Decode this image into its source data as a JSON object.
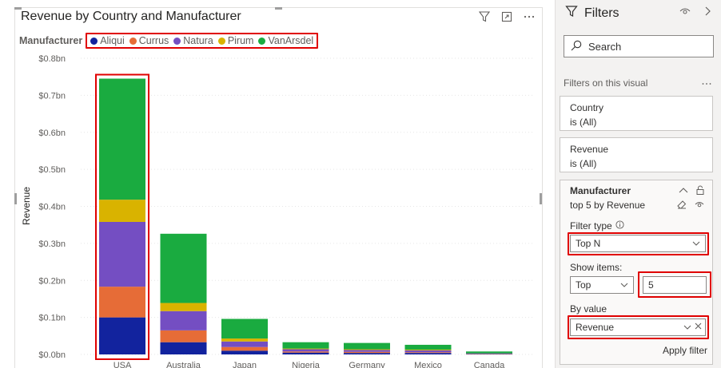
{
  "visual": {
    "title": "Revenue by Country and Manufacturer",
    "legend_title": "Manufacturer",
    "legend": [
      {
        "name": "Aliqui",
        "color": "#12239e"
      },
      {
        "name": "Currus",
        "color": "#e66c37"
      },
      {
        "name": "Natura",
        "color": "#744ec2"
      },
      {
        "name": "Pirum",
        "color": "#d9b300"
      },
      {
        "name": "VanArsdel",
        "color": "#1aab40"
      }
    ],
    "actions": [
      "filter-icon",
      "focus-mode-icon",
      "more-options-icon"
    ]
  },
  "chart_data": {
    "type": "bar",
    "stacked": true,
    "ylabel": "Revenue",
    "ylim": [
      0,
      0.8
    ],
    "yticks": [
      "$0.0bn",
      "$0.1bn",
      "$0.2bn",
      "$0.3bn",
      "$0.4bn",
      "$0.5bn",
      "$0.6bn",
      "$0.7bn",
      "$0.8bn"
    ],
    "grid": true,
    "categories": [
      "USA",
      "Australia",
      "Japan",
      "Nigeria",
      "Germany",
      "Mexico",
      "Canada"
    ],
    "series": [
      {
        "name": "Aliqui",
        "color": "#12239e",
        "values": [
          0.1,
          0.033,
          0.01,
          0.005,
          0.004,
          0.004,
          0.001
        ]
      },
      {
        "name": "Currus",
        "color": "#e66c37",
        "values": [
          0.083,
          0.032,
          0.01,
          0.003,
          0.003,
          0.002,
          0.001
        ]
      },
      {
        "name": "Natura",
        "color": "#744ec2",
        "values": [
          0.175,
          0.052,
          0.015,
          0.006,
          0.005,
          0.005,
          0.001
        ]
      },
      {
        "name": "Pirum",
        "color": "#d9b300",
        "values": [
          0.06,
          0.022,
          0.008,
          0.002,
          0.002,
          0.002,
          0.0
        ]
      },
      {
        "name": "VanArsdel",
        "color": "#1aab40",
        "values": [
          0.327,
          0.187,
          0.053,
          0.017,
          0.017,
          0.013,
          0.005
        ]
      }
    ]
  },
  "filters": {
    "title": "Filters",
    "search_placeholder": "Search",
    "section_label": "Filters on this visual",
    "cards": [
      {
        "field": "Country",
        "state": "is (All)"
      },
      {
        "field": "Revenue",
        "state": "is (All)"
      }
    ],
    "expanded": {
      "field": "Manufacturer",
      "summary": "top 5 by Revenue",
      "filter_type_label": "Filter type",
      "filter_type_value": "Top N",
      "show_items_label": "Show items:",
      "show_items_direction": "Top",
      "show_items_count": "5",
      "by_value_label": "By value",
      "by_value_field": "Revenue",
      "apply_label": "Apply filter"
    }
  }
}
